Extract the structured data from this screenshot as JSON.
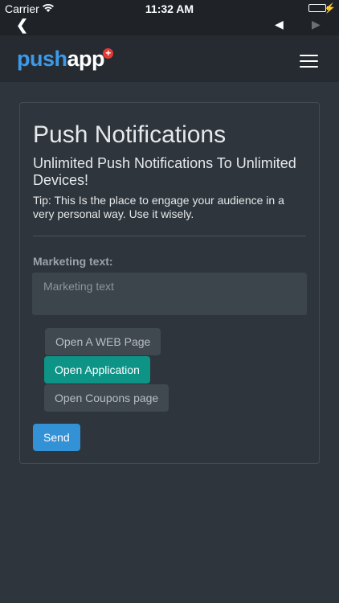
{
  "status_bar": {
    "carrier": "Carrier",
    "wifi_icon": "wifi-icon",
    "time": "11:32 AM",
    "battery_icon": "battery-icon",
    "charging_icon": "lightning-bolt-icon",
    "battery_color": "#4cd964"
  },
  "nav_row": {
    "back_icon": "chevron-left-icon",
    "back_glyph": "❮",
    "prev_icon": "play-left-icon",
    "prev_glyph": "◀",
    "next_icon": "play-right-icon",
    "next_glyph": "▶"
  },
  "header": {
    "logo_push": "push",
    "logo_app": "app",
    "logo_plus": "+",
    "menu_icon": "hamburger-menu-icon",
    "logo_color": "#3d9ae8",
    "badge_color": "#e53935"
  },
  "main": {
    "title": "Push Notifications",
    "subtitle": "Unlimited Push Notifications To Unlimited Devices!",
    "tip": "Tip: This Is the place to engage your audience in a very personal way. Use it wisely.",
    "marketing_label": "Marketing text:",
    "marketing_placeholder": "Marketing text",
    "marketing_value": "",
    "options": [
      {
        "label": "Open A WEB Page",
        "selected": false
      },
      {
        "label": "Open Application",
        "selected": true
      },
      {
        "label": "Open Coupons page",
        "selected": false
      }
    ],
    "send_label": "Send",
    "accent_color": "#0e9486",
    "send_color": "#3391d6"
  }
}
